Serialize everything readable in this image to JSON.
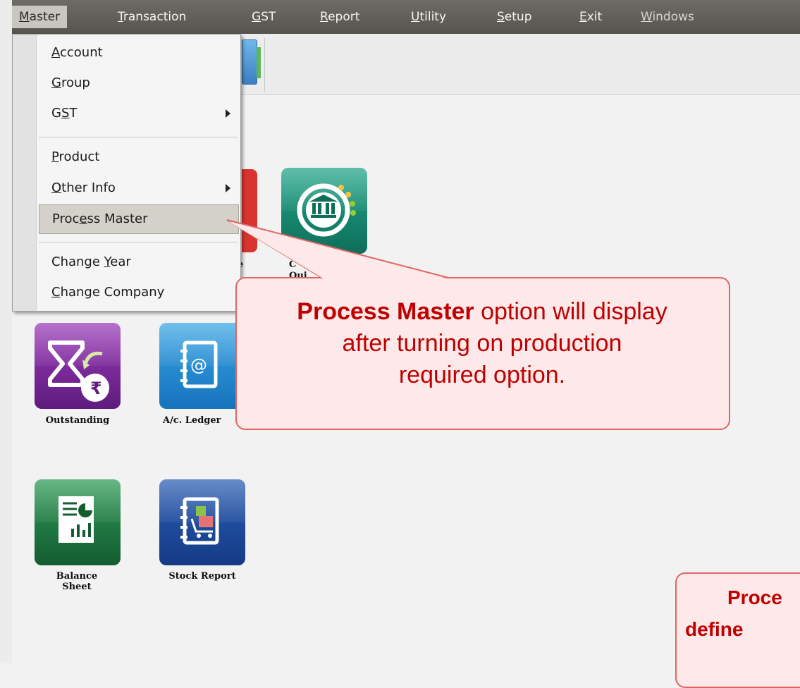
{
  "menubar": {
    "items": [
      {
        "prefix": "",
        "ul": "M",
        "rest": "aster"
      },
      {
        "prefix": "",
        "ul": "T",
        "rest": "ransaction"
      },
      {
        "prefix": "",
        "ul": "G",
        "rest": "ST"
      },
      {
        "prefix": "",
        "ul": "R",
        "rest": "eport"
      },
      {
        "prefix": "",
        "ul": "U",
        "rest": "tility"
      },
      {
        "prefix": "",
        "ul": "S",
        "rest": "etup"
      },
      {
        "prefix": "",
        "ul": "E",
        "rest": "xit"
      },
      {
        "prefix": "",
        "ul": "W",
        "rest": "indows"
      }
    ]
  },
  "dropdown": {
    "items": [
      {
        "prefix": "",
        "ul": "A",
        "rest": "ccount"
      },
      {
        "prefix": "",
        "ul": "G",
        "rest": "roup"
      },
      {
        "prefix": "G",
        "ul": "S",
        "rest": "T"
      },
      {
        "prefix": "",
        "ul": "P",
        "rest": "roduct"
      },
      {
        "prefix": "",
        "ul": "O",
        "rest": "ther Info"
      },
      {
        "prefix": "Proc",
        "ul": "e",
        "rest": "ss Master"
      },
      {
        "prefix": "Change ",
        "ul": "Y",
        "rest": "ear"
      },
      {
        "prefix": "",
        "ul": "C",
        "rest": "hange Company"
      }
    ]
  },
  "tiles": {
    "outstanding": "Outstanding",
    "ledger": "A/c. Ledger",
    "balance_l1": "Balance",
    "balance_l2": "Sheet",
    "stock": "Stock Report",
    "partial_left": "e",
    "partial_mid1": "C",
    "partial_mid2": "Qui"
  },
  "callout": {
    "bold": "Process Master",
    "line1_rest": " option will display",
    "line2": "after turning on production",
    "line3": "required option."
  },
  "callout2": {
    "line1": "Proce",
    "line2": "define"
  },
  "colors": {
    "accent_red": "#c00000",
    "callout_bg": "#fde9e9",
    "menubar": "#5f5b56"
  }
}
